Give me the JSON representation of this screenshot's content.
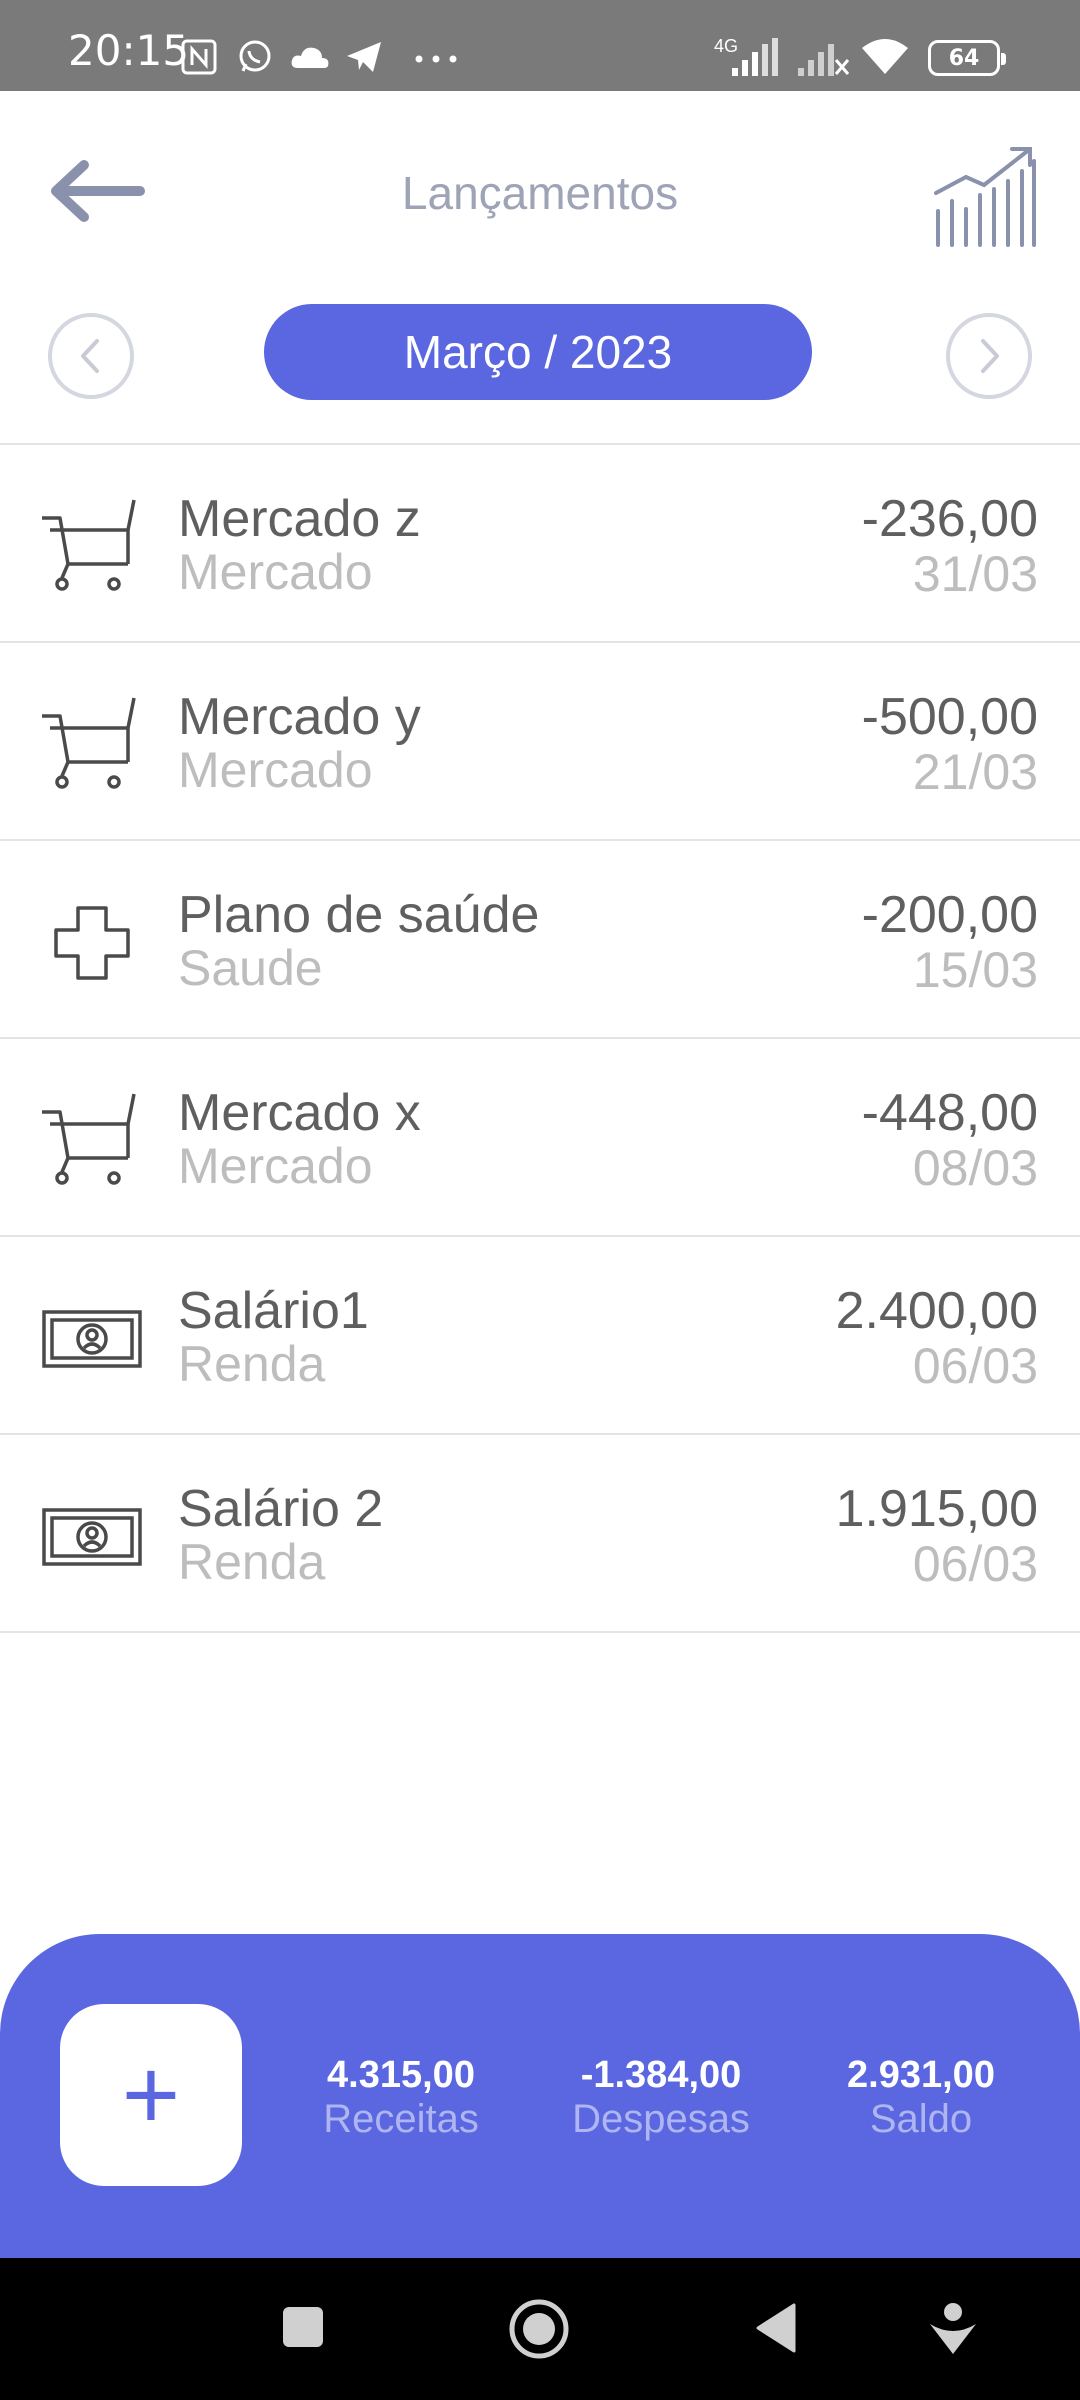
{
  "status_bar": {
    "time": "20:15",
    "network_label": "4G",
    "battery_level": "64",
    "icons": [
      "nfc-icon",
      "whatsapp-icon",
      "cloud-icon",
      "telegram-icon",
      "more-dots-icon",
      "signal-icon",
      "signal-off-icon",
      "wifi-icon",
      "battery-icon"
    ]
  },
  "header": {
    "title": "Lançamentos",
    "back_icon": "arrow-left-icon",
    "chart_icon": "trend-chart-icon"
  },
  "month_selector": {
    "label": "Março / 2023",
    "prev_icon": "chevron-left-icon",
    "next_icon": "chevron-right-icon"
  },
  "transactions": [
    {
      "name": "Mercado z",
      "category": "Mercado",
      "amount": "-236,00",
      "date": "31/03",
      "icon": "cart-icon"
    },
    {
      "name": "Mercado y",
      "category": "Mercado",
      "amount": "-500,00",
      "date": "21/03",
      "icon": "cart-icon"
    },
    {
      "name": "Plano de saúde",
      "category": "Saude",
      "amount": "-200,00",
      "date": "15/03",
      "icon": "health-cross-icon"
    },
    {
      "name": "Mercado x",
      "category": "Mercado",
      "amount": "-448,00",
      "date": "08/03",
      "icon": "cart-icon"
    },
    {
      "name": "Salário1",
      "category": "Renda",
      "amount": "2.400,00",
      "date": "06/03",
      "icon": "banknote-icon"
    },
    {
      "name": "Salário 2",
      "category": "Renda",
      "amount": "1.915,00",
      "date": "06/03",
      "icon": "banknote-icon"
    }
  ],
  "summary": {
    "add_label": "+",
    "income_value": "4.315,00",
    "income_label": "Receitas",
    "expense_value": "-1.384,00",
    "expense_label": "Despesas",
    "balance_value": "2.931,00",
    "balance_label": "Saldo"
  },
  "colors": {
    "accent": "#5a67e0",
    "text_primary": "#5f5f5f",
    "text_secondary": "#bdbdbd",
    "status_bar": "#7a7a7a"
  },
  "nav_bar": {
    "icons": [
      "recents-square-icon",
      "home-circle-icon",
      "back-triangle-icon",
      "assistant-icon"
    ]
  }
}
